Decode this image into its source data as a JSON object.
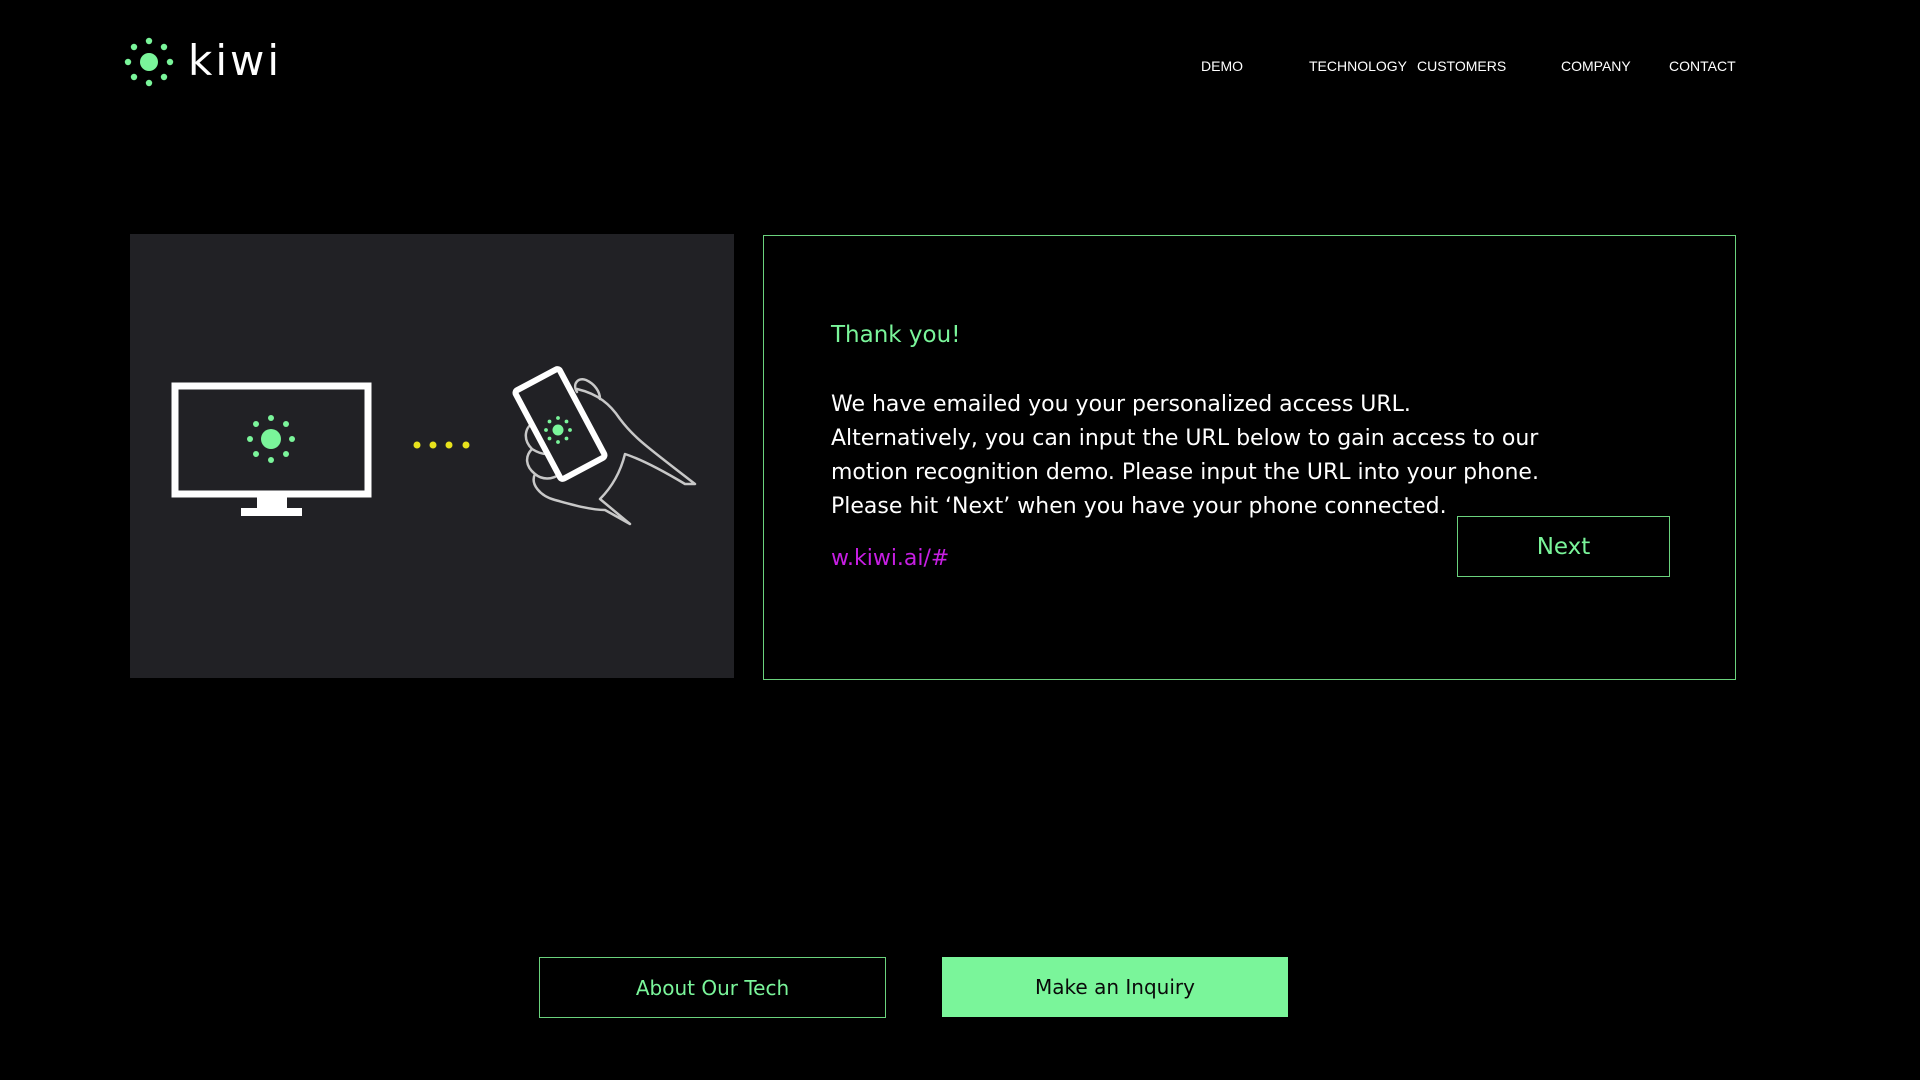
{
  "brand": {
    "name": "kiwi",
    "accent_color": "#7af59a",
    "logo_icon": "sun-icon"
  },
  "nav": {
    "items": [
      {
        "label": "DEMO"
      },
      {
        "label": "TECHNOLOGY"
      },
      {
        "label": "CUSTOMERS"
      },
      {
        "label": "COMPANY"
      },
      {
        "label": "CONTACT"
      }
    ]
  },
  "illustration": {
    "icons": [
      "monitor-icon",
      "sun-icon",
      "dots-icon",
      "phone-in-hand-icon"
    ],
    "dots_color": "#e8e21c"
  },
  "card": {
    "heading": "Thank you!",
    "body": "We have emailed you your personalized access URL. Alternatively, you can input the URL below to gain access to our motion recognition demo. Please input the URL into your phone. Please hit ‘Next’ when you have your phone connected.",
    "url": "w.kiwi.ai/#",
    "url_color": "#c71fe3",
    "next_label": "Next"
  },
  "footer": {
    "about_label": "About Our Tech",
    "inquiry_label": "Make an Inquiry"
  }
}
